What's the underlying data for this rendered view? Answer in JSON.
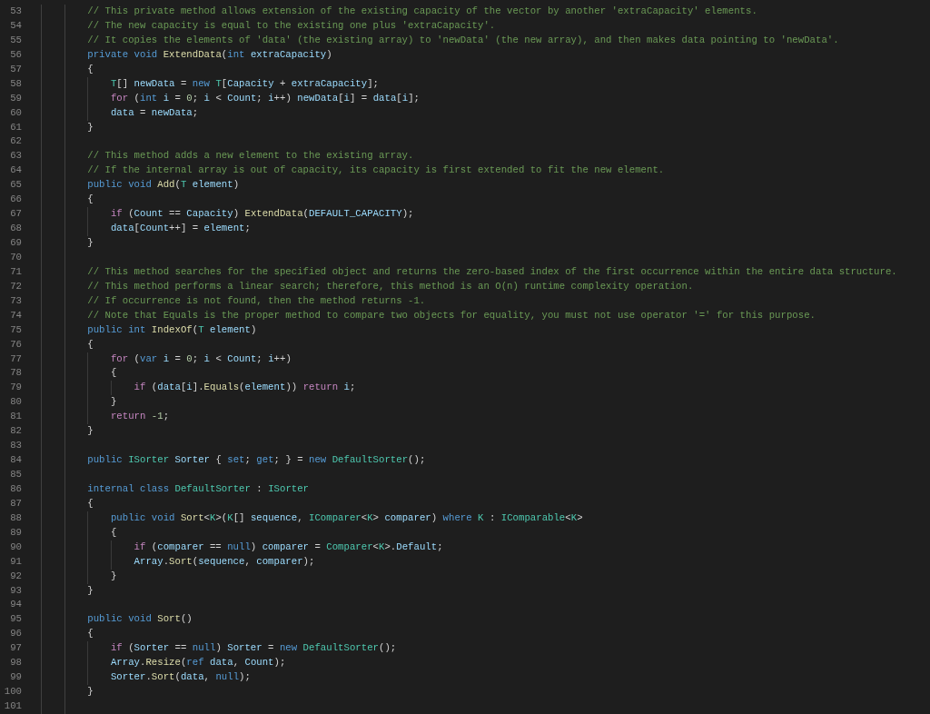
{
  "editor": {
    "lines": [
      {
        "number": "53",
        "tokens": [
          {
            "kind": "comment",
            "text": "        // This private method allows extension of the existing capacity of the vector by another 'extraCapacity' elements."
          }
        ]
      },
      {
        "number": "54",
        "tokens": [
          {
            "kind": "comment",
            "text": "        // The new capacity is equal to the existing one plus 'extraCapacity'."
          }
        ]
      },
      {
        "number": "55",
        "tokens": [
          {
            "kind": "comment",
            "text": "        // It copies the elements of 'data' (the existing array) to 'newData' (the new array), and then makes data pointing to 'newData'."
          }
        ]
      },
      {
        "number": "56",
        "tokens": [
          {
            "kind": "keyword",
            "text": "        private void "
          },
          {
            "kind": "function",
            "text": "ExtendData"
          },
          {
            "kind": "plain",
            "text": "("
          },
          {
            "kind": "keyword",
            "text": "int "
          },
          {
            "kind": "variable",
            "text": "extraCapacity"
          },
          {
            "kind": "plain",
            "text": ")"
          }
        ]
      },
      {
        "number": "57",
        "tokens": [
          {
            "kind": "plain",
            "text": "        {"
          }
        ]
      },
      {
        "number": "58",
        "tokens": [
          {
            "kind": "type",
            "text": "            T"
          },
          {
            "kind": "plain",
            "text": "[] "
          },
          {
            "kind": "variable",
            "text": "newData"
          },
          {
            "kind": "plain",
            "text": " = "
          },
          {
            "kind": "keyword",
            "text": "new "
          },
          {
            "kind": "type",
            "text": "T"
          },
          {
            "kind": "plain",
            "text": "["
          },
          {
            "kind": "variable",
            "text": "Capacity"
          },
          {
            "kind": "plain",
            "text": " + "
          },
          {
            "kind": "variable",
            "text": "extraCapacity"
          },
          {
            "kind": "plain",
            "text": "];"
          }
        ]
      },
      {
        "number": "59",
        "tokens": [
          {
            "kind": "control",
            "text": "            for "
          },
          {
            "kind": "plain",
            "text": "("
          },
          {
            "kind": "keyword",
            "text": "int "
          },
          {
            "kind": "variable",
            "text": "i"
          },
          {
            "kind": "plain",
            "text": " = "
          },
          {
            "kind": "number",
            "text": "0"
          },
          {
            "kind": "plain",
            "text": "; "
          },
          {
            "kind": "variable",
            "text": "i"
          },
          {
            "kind": "plain",
            "text": " < "
          },
          {
            "kind": "variable",
            "text": "Count"
          },
          {
            "kind": "plain",
            "text": "; "
          },
          {
            "kind": "variable",
            "text": "i"
          },
          {
            "kind": "plain",
            "text": "++) "
          },
          {
            "kind": "variable",
            "text": "newData"
          },
          {
            "kind": "plain",
            "text": "["
          },
          {
            "kind": "variable",
            "text": "i"
          },
          {
            "kind": "plain",
            "text": "] = "
          },
          {
            "kind": "variable",
            "text": "data"
          },
          {
            "kind": "plain",
            "text": "["
          },
          {
            "kind": "variable",
            "text": "i"
          },
          {
            "kind": "plain",
            "text": "];"
          }
        ]
      },
      {
        "number": "60",
        "tokens": [
          {
            "kind": "variable",
            "text": "            data"
          },
          {
            "kind": "plain",
            "text": " = "
          },
          {
            "kind": "variable",
            "text": "newData"
          },
          {
            "kind": "plain",
            "text": ";"
          }
        ]
      },
      {
        "number": "61",
        "tokens": [
          {
            "kind": "plain",
            "text": "        }"
          }
        ]
      },
      {
        "number": "62"
      },
      {
        "number": "63",
        "tokens": [
          {
            "kind": "comment",
            "text": "        // This method adds a new element to the existing array."
          }
        ]
      },
      {
        "number": "64",
        "tokens": [
          {
            "kind": "comment",
            "text": "        // If the internal array is out of capacity, its capacity is first extended to fit the new element."
          }
        ]
      },
      {
        "number": "65",
        "tokens": [
          {
            "kind": "keyword",
            "text": "        public void "
          },
          {
            "kind": "function",
            "text": "Add"
          },
          {
            "kind": "plain",
            "text": "("
          },
          {
            "kind": "type",
            "text": "T "
          },
          {
            "kind": "variable",
            "text": "element"
          },
          {
            "kind": "plain",
            "text": ")"
          }
        ]
      },
      {
        "number": "66",
        "tokens": [
          {
            "kind": "plain",
            "text": "        {"
          }
        ]
      },
      {
        "number": "67",
        "tokens": [
          {
            "kind": "control",
            "text": "            if "
          },
          {
            "kind": "plain",
            "text": "("
          },
          {
            "kind": "variable",
            "text": "Count"
          },
          {
            "kind": "plain",
            "text": " == "
          },
          {
            "kind": "variable",
            "text": "Capacity"
          },
          {
            "kind": "plain",
            "text": ") "
          },
          {
            "kind": "function",
            "text": "ExtendData"
          },
          {
            "kind": "plain",
            "text": "("
          },
          {
            "kind": "variable",
            "text": "DEFAULT_CAPACITY"
          },
          {
            "kind": "plain",
            "text": ");"
          }
        ]
      },
      {
        "number": "68",
        "tokens": [
          {
            "kind": "variable",
            "text": "            data"
          },
          {
            "kind": "plain",
            "text": "["
          },
          {
            "kind": "variable",
            "text": "Count"
          },
          {
            "kind": "plain",
            "text": "++] = "
          },
          {
            "kind": "variable",
            "text": "element"
          },
          {
            "kind": "plain",
            "text": ";"
          }
        ]
      },
      {
        "number": "69",
        "tokens": [
          {
            "kind": "plain",
            "text": "        }"
          }
        ]
      },
      {
        "number": "70"
      },
      {
        "number": "71",
        "tokens": [
          {
            "kind": "comment",
            "text": "        // This method searches for the specified object and returns the zero-based index of the first occurrence within the entire data structure."
          }
        ]
      },
      {
        "number": "72",
        "tokens": [
          {
            "kind": "comment",
            "text": "        // This method performs a linear search; therefore, this method is an O(n) runtime complexity operation."
          }
        ]
      },
      {
        "number": "73",
        "tokens": [
          {
            "kind": "comment",
            "text": "        // If occurrence is not found, then the method returns -1."
          }
        ]
      },
      {
        "number": "74",
        "tokens": [
          {
            "kind": "comment",
            "text": "        // Note that Equals is the proper method to compare two objects for equality, you must not use operator '=' for this purpose."
          }
        ]
      },
      {
        "number": "75",
        "tokens": [
          {
            "kind": "keyword",
            "text": "        public int "
          },
          {
            "kind": "function",
            "text": "IndexOf"
          },
          {
            "kind": "plain",
            "text": "("
          },
          {
            "kind": "type",
            "text": "T "
          },
          {
            "kind": "variable",
            "text": "element"
          },
          {
            "kind": "plain",
            "text": ")"
          }
        ]
      },
      {
        "number": "76",
        "tokens": [
          {
            "kind": "plain",
            "text": "        {"
          }
        ]
      },
      {
        "number": "77",
        "tokens": [
          {
            "kind": "control",
            "text": "            for "
          },
          {
            "kind": "plain",
            "text": "("
          },
          {
            "kind": "keyword",
            "text": "var "
          },
          {
            "kind": "variable",
            "text": "i"
          },
          {
            "kind": "plain",
            "text": " = "
          },
          {
            "kind": "number",
            "text": "0"
          },
          {
            "kind": "plain",
            "text": "; "
          },
          {
            "kind": "variable",
            "text": "i"
          },
          {
            "kind": "plain",
            "text": " < "
          },
          {
            "kind": "variable",
            "text": "Count"
          },
          {
            "kind": "plain",
            "text": "; "
          },
          {
            "kind": "variable",
            "text": "i"
          },
          {
            "kind": "plain",
            "text": "++)"
          }
        ]
      },
      {
        "number": "78",
        "tokens": [
          {
            "kind": "plain",
            "text": "            {"
          }
        ]
      },
      {
        "number": "79",
        "tokens": [
          {
            "kind": "control",
            "text": "                if "
          },
          {
            "kind": "plain",
            "text": "("
          },
          {
            "kind": "variable",
            "text": "data"
          },
          {
            "kind": "plain",
            "text": "["
          },
          {
            "kind": "variable",
            "text": "i"
          },
          {
            "kind": "plain",
            "text": "]."
          },
          {
            "kind": "function",
            "text": "Equals"
          },
          {
            "kind": "plain",
            "text": "("
          },
          {
            "kind": "variable",
            "text": "element"
          },
          {
            "kind": "plain",
            "text": ")) "
          },
          {
            "kind": "control",
            "text": "return "
          },
          {
            "kind": "variable",
            "text": "i"
          },
          {
            "kind": "plain",
            "text": ";"
          }
        ]
      },
      {
        "number": "80",
        "tokens": [
          {
            "kind": "plain",
            "text": "            }"
          }
        ]
      },
      {
        "number": "81",
        "tokens": [
          {
            "kind": "control",
            "text": "            return "
          },
          {
            "kind": "number",
            "text": "-1"
          },
          {
            "kind": "plain",
            "text": ";"
          }
        ]
      },
      {
        "number": "82",
        "tokens": [
          {
            "kind": "plain",
            "text": "        }"
          }
        ]
      },
      {
        "number": "83"
      },
      {
        "number": "84",
        "tokens": [
          {
            "kind": "keyword",
            "text": "        public "
          },
          {
            "kind": "type",
            "text": "ISorter "
          },
          {
            "kind": "variable",
            "text": "Sorter"
          },
          {
            "kind": "plain",
            "text": " { "
          },
          {
            "kind": "keyword",
            "text": "set"
          },
          {
            "kind": "plain",
            "text": "; "
          },
          {
            "kind": "keyword",
            "text": "get"
          },
          {
            "kind": "plain",
            "text": "; } = "
          },
          {
            "kind": "keyword",
            "text": "new "
          },
          {
            "kind": "type",
            "text": "DefaultSorter"
          },
          {
            "kind": "plain",
            "text": "();"
          }
        ]
      },
      {
        "number": "85"
      },
      {
        "number": "86",
        "tokens": [
          {
            "kind": "keyword",
            "text": "        internal class "
          },
          {
            "kind": "type",
            "text": "DefaultSorter"
          },
          {
            "kind": "plain",
            "text": " : "
          },
          {
            "kind": "type",
            "text": "ISorter"
          }
        ]
      },
      {
        "number": "87",
        "tokens": [
          {
            "kind": "plain",
            "text": "        {"
          }
        ]
      },
      {
        "number": "88",
        "tokens": [
          {
            "kind": "keyword",
            "text": "            public void "
          },
          {
            "kind": "function",
            "text": "Sort"
          },
          {
            "kind": "plain",
            "text": "<"
          },
          {
            "kind": "type",
            "text": "K"
          },
          {
            "kind": "plain",
            "text": ">("
          },
          {
            "kind": "type",
            "text": "K"
          },
          {
            "kind": "plain",
            "text": "[] "
          },
          {
            "kind": "variable",
            "text": "sequence"
          },
          {
            "kind": "plain",
            "text": ", "
          },
          {
            "kind": "type",
            "text": "IComparer"
          },
          {
            "kind": "plain",
            "text": "<"
          },
          {
            "kind": "type",
            "text": "K"
          },
          {
            "kind": "plain",
            "text": "> "
          },
          {
            "kind": "variable",
            "text": "comparer"
          },
          {
            "kind": "plain",
            "text": ") "
          },
          {
            "kind": "keyword",
            "text": "where "
          },
          {
            "kind": "type",
            "text": "K"
          },
          {
            "kind": "plain",
            "text": " : "
          },
          {
            "kind": "type",
            "text": "IComparable"
          },
          {
            "kind": "plain",
            "text": "<"
          },
          {
            "kind": "type",
            "text": "K"
          },
          {
            "kind": "plain",
            "text": ">"
          }
        ]
      },
      {
        "number": "89",
        "tokens": [
          {
            "kind": "plain",
            "text": "            {"
          }
        ]
      },
      {
        "number": "90",
        "tokens": [
          {
            "kind": "control",
            "text": "                if "
          },
          {
            "kind": "plain",
            "text": "("
          },
          {
            "kind": "variable",
            "text": "comparer"
          },
          {
            "kind": "plain",
            "text": " == "
          },
          {
            "kind": "keyword",
            "text": "null"
          },
          {
            "kind": "plain",
            "text": ") "
          },
          {
            "kind": "variable",
            "text": "comparer"
          },
          {
            "kind": "plain",
            "text": " = "
          },
          {
            "kind": "type",
            "text": "Comparer"
          },
          {
            "kind": "plain",
            "text": "<"
          },
          {
            "kind": "type",
            "text": "K"
          },
          {
            "kind": "plain",
            "text": ">."
          },
          {
            "kind": "variable",
            "text": "Default"
          },
          {
            "kind": "plain",
            "text": ";"
          }
        ]
      },
      {
        "number": "91",
        "tokens": [
          {
            "kind": "variable",
            "text": "                Array"
          },
          {
            "kind": "plain",
            "text": "."
          },
          {
            "kind": "function",
            "text": "Sort"
          },
          {
            "kind": "plain",
            "text": "("
          },
          {
            "kind": "variable",
            "text": "sequence"
          },
          {
            "kind": "plain",
            "text": ", "
          },
          {
            "kind": "variable",
            "text": "comparer"
          },
          {
            "kind": "plain",
            "text": ");"
          }
        ]
      },
      {
        "number": "92",
        "tokens": [
          {
            "kind": "plain",
            "text": "            }"
          }
        ]
      },
      {
        "number": "93",
        "tokens": [
          {
            "kind": "plain",
            "text": "        }"
          }
        ]
      },
      {
        "number": "94"
      },
      {
        "number": "95",
        "tokens": [
          {
            "kind": "keyword",
            "text": "        public void "
          },
          {
            "kind": "function",
            "text": "Sort"
          },
          {
            "kind": "plain",
            "text": "()"
          }
        ]
      },
      {
        "number": "96",
        "tokens": [
          {
            "kind": "plain",
            "text": "        {"
          }
        ]
      },
      {
        "number": "97",
        "tokens": [
          {
            "kind": "control",
            "text": "            if "
          },
          {
            "kind": "plain",
            "text": "("
          },
          {
            "kind": "variable",
            "text": "Sorter"
          },
          {
            "kind": "plain",
            "text": " == "
          },
          {
            "kind": "keyword",
            "text": "null"
          },
          {
            "kind": "plain",
            "text": ") "
          },
          {
            "kind": "variable",
            "text": "Sorter"
          },
          {
            "kind": "plain",
            "text": " = "
          },
          {
            "kind": "keyword",
            "text": "new "
          },
          {
            "kind": "type",
            "text": "DefaultSorter"
          },
          {
            "kind": "plain",
            "text": "();"
          }
        ]
      },
      {
        "number": "98",
        "tokens": [
          {
            "kind": "variable",
            "text": "            Array"
          },
          {
            "kind": "plain",
            "text": "."
          },
          {
            "kind": "function",
            "text": "Resize"
          },
          {
            "kind": "plain",
            "text": "("
          },
          {
            "kind": "keyword",
            "text": "ref "
          },
          {
            "kind": "variable",
            "text": "data"
          },
          {
            "kind": "plain",
            "text": ", "
          },
          {
            "kind": "variable",
            "text": "Count"
          },
          {
            "kind": "plain",
            "text": ");"
          }
        ]
      },
      {
        "number": "99",
        "tokens": [
          {
            "kind": "variable",
            "text": "            Sorter"
          },
          {
            "kind": "plain",
            "text": "."
          },
          {
            "kind": "function",
            "text": "Sort"
          },
          {
            "kind": "plain",
            "text": "("
          },
          {
            "kind": "variable",
            "text": "data"
          },
          {
            "kind": "plain",
            "text": ", "
          },
          {
            "kind": "keyword",
            "text": "null"
          },
          {
            "kind": "plain",
            "text": ");"
          }
        ]
      },
      {
        "number": "100",
        "tokens": [
          {
            "kind": "plain",
            "text": "        }"
          }
        ]
      },
      {
        "number": "101"
      }
    ]
  }
}
